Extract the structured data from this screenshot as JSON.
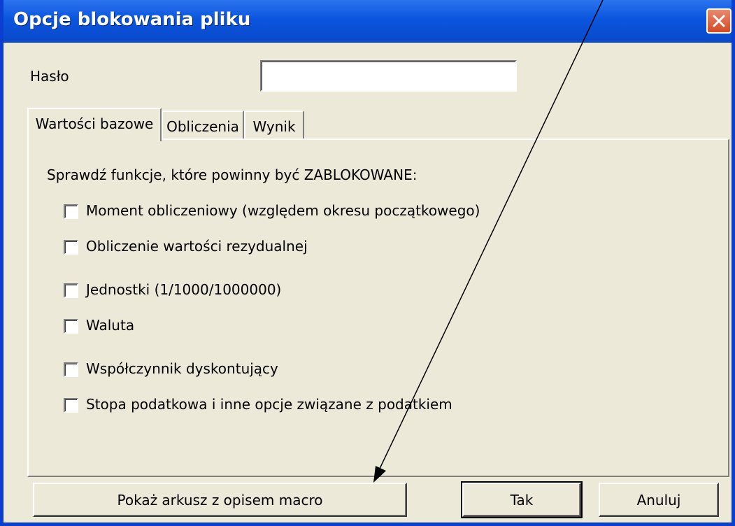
{
  "window": {
    "title": "Opcje blokowania pliku"
  },
  "password": {
    "label": "Hasło",
    "value": ""
  },
  "tabs": [
    {
      "label": "Wartości bazowe",
      "active": true
    },
    {
      "label": "Obliczenia",
      "active": false
    },
    {
      "label": "Wynik",
      "active": false
    }
  ],
  "panel": {
    "instruction": "Sprawdź funkcje, które powinny być ZABLOKOWANE:",
    "options": [
      {
        "label": "Moment obliczeniowy (względem okresu początkowego)",
        "checked": false
      },
      {
        "label": "Obliczenie wartości rezydualnej",
        "checked": false
      },
      {
        "label": "Jednostki (1/1000/1000000)",
        "checked": false
      },
      {
        "label": "Waluta",
        "checked": false
      },
      {
        "label": "Współczynnik dyskontujący",
        "checked": false
      },
      {
        "label": "Stopa podatkowa i inne opcje związane z podatkiem",
        "checked": false
      }
    ]
  },
  "buttons": {
    "show_macro_sheet": "Pokaż arkusz z opisem macro",
    "ok": "Tak",
    "cancel": "Anuluj"
  },
  "colors": {
    "titlebar": "#0b55de",
    "face": "#ece9d8",
    "close": "#d24a25"
  },
  "icons": {
    "close": "close-icon",
    "annotation": "annotation-arrow"
  }
}
